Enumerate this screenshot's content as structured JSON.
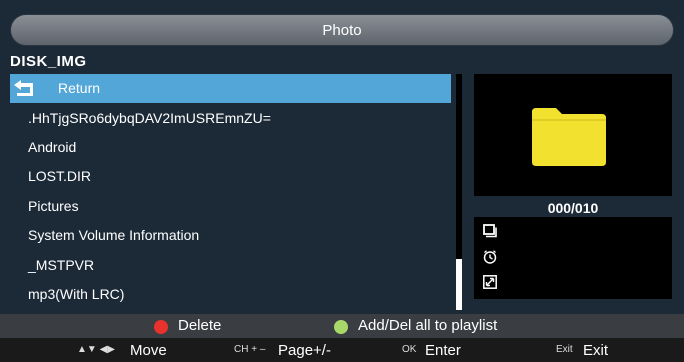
{
  "title": "Photo",
  "path": "DISK_IMG",
  "list": {
    "return_label": "Return",
    "items": [
      ".HhTjgSRo6dybqDAV2ImUSREmnZU=",
      "Android",
      "LOST.DIR",
      "Pictures",
      "System Volume Information",
      "_MSTPVR",
      "mp3(With LRC)"
    ]
  },
  "preview": {
    "icon": "folder-icon",
    "counter": "000/010"
  },
  "info_icons": [
    "size-icon",
    "clock-icon",
    "resolution-icon"
  ],
  "legend": {
    "delete_label": "Delete",
    "playlist_label": "Add/Del all to playlist",
    "red": "#e8322e",
    "green": "#a8d86a"
  },
  "hints": {
    "move_keys": "▲▼ ◀▶",
    "move_label": "Move",
    "page_keys": "CH + –",
    "page_label": "Page+/-",
    "enter_keys": "OK",
    "enter_label": "Enter",
    "exit_keys": "Exit",
    "exit_label": "Exit"
  },
  "scroll": {
    "position": 1.0
  }
}
